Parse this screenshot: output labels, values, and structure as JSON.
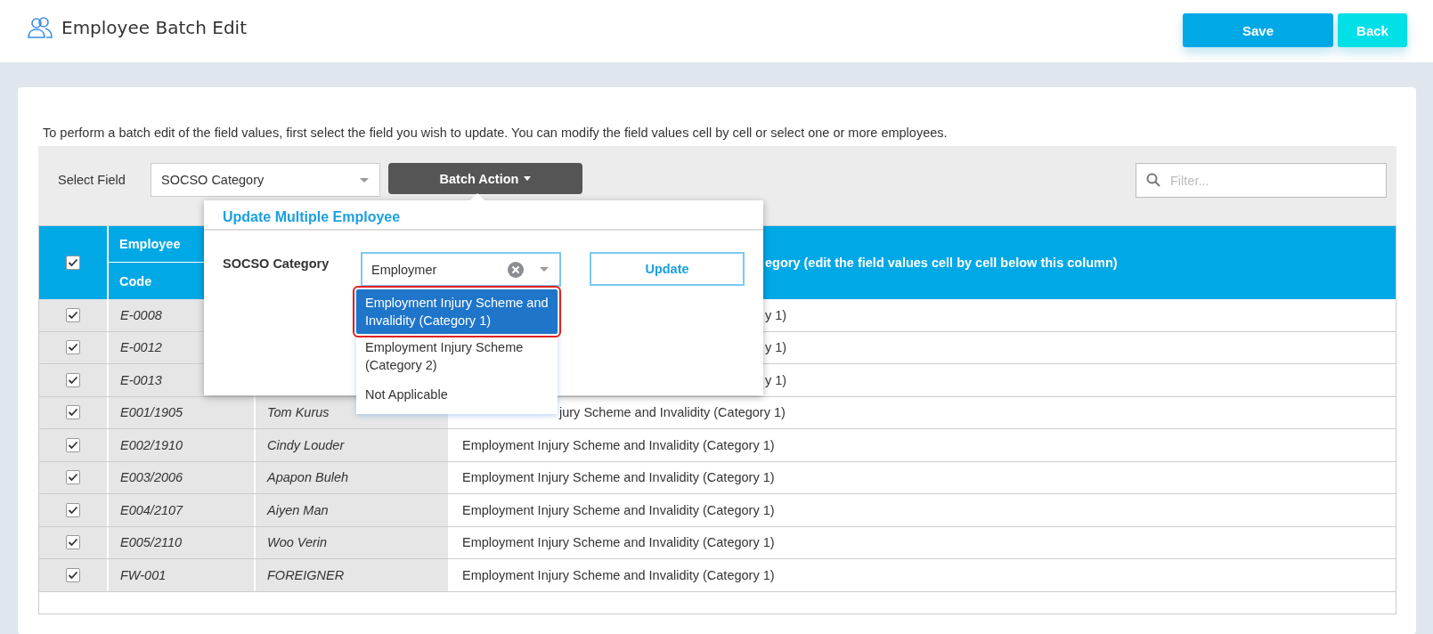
{
  "header": {
    "title": "Employee Batch Edit",
    "buttons": [
      {
        "label": "Save",
        "kind": "primary"
      },
      {
        "label": "Back",
        "kind": "secondary"
      }
    ]
  },
  "instructions": "To perform a batch edit of the field values, first select the field you wish to update. You can modify the field values cell by cell or select one or more employees.",
  "toolbar": {
    "field_label": "Select Field",
    "field_value": "SOCSO Category",
    "batch_button": "Batch Action",
    "filter": {
      "placeholder": "Filter..."
    }
  },
  "table": {
    "select_all_checked": true,
    "code_header": [
      "Employee",
      "Code"
    ],
    "value_header": "egory (edit the field values cell by cell below this column)",
    "rows": [
      {
        "checked": true,
        "code": "E-0008",
        "value": "y 1)"
      },
      {
        "checked": true,
        "code": "E-0012",
        "value": "y 1)"
      },
      {
        "checked": true,
        "code": "E-0013",
        "value": "y 1)"
      },
      {
        "checked": true,
        "code": "E001/1905",
        "name": "Tom Kurus",
        "value": "jury Scheme and Invalidity (Category 1)"
      },
      {
        "checked": true,
        "code": "E002/1910",
        "name": "Cindy Louder",
        "value": "Employment Injury Scheme and Invalidity (Category 1)"
      },
      {
        "checked": true,
        "code": "E003/2006",
        "name": "Apapon Buleh",
        "value": "Employment Injury Scheme and Invalidity (Category 1)"
      },
      {
        "checked": true,
        "code": "E004/2107",
        "name": "Aiyen Man",
        "value": "Employment Injury Scheme and Invalidity (Category 1)"
      },
      {
        "checked": true,
        "code": "E005/2110",
        "name": "Woo Verin",
        "value": "Employment Injury Scheme and Invalidity (Category 1)"
      },
      {
        "checked": true,
        "code": "FW-001",
        "name": "FOREIGNER",
        "value": "Employment Injury Scheme and Invalidity (Category 1)"
      }
    ]
  },
  "popup": {
    "title": "Update Multiple Employee",
    "field_label": "SOCSO Category",
    "combo_value": "Employmer",
    "update_button": "Update",
    "options": [
      {
        "label": "Employment Injury Scheme and Invalidity (Category 1)",
        "selected": true,
        "outlined": true
      },
      {
        "label": "Employment Injury Scheme (Category 2)",
        "selected": false,
        "outlined": false
      },
      {
        "label": "Not Applicable",
        "selected": false,
        "outlined": false
      }
    ]
  }
}
